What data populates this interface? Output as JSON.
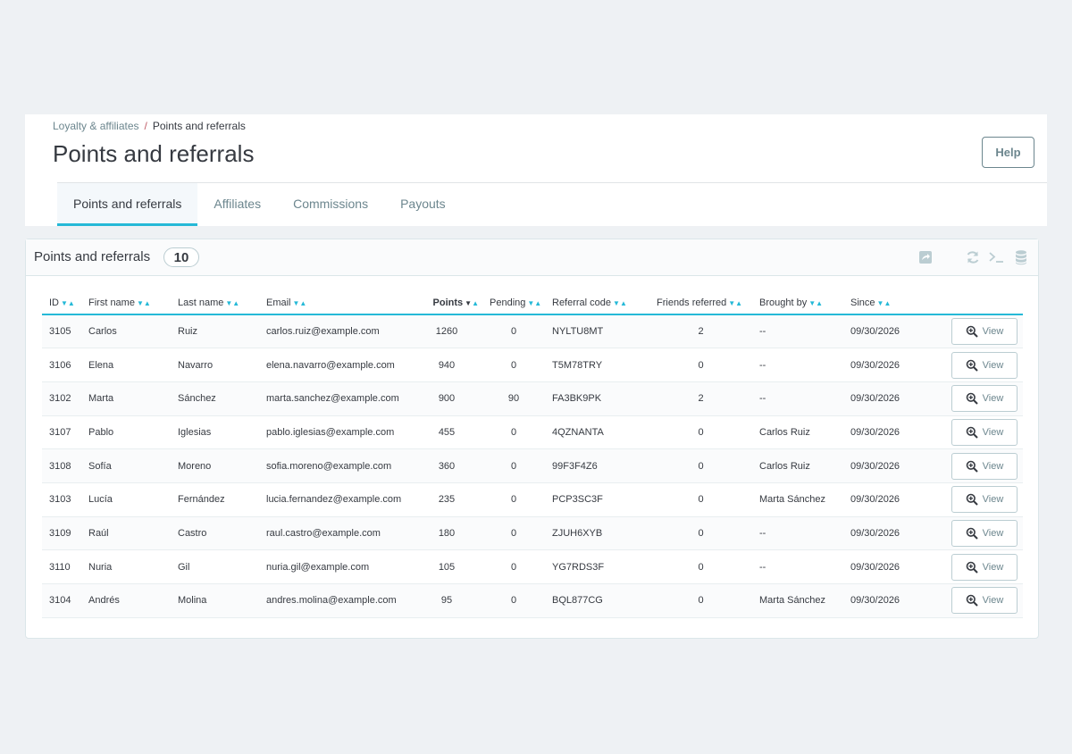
{
  "breadcrumb": {
    "parent": "Loyalty & affiliates",
    "separator": "/",
    "current": "Points and referrals"
  },
  "page_title": "Points and referrals",
  "help_label": "Help",
  "tabs": [
    {
      "label": "Points and referrals",
      "active": true
    },
    {
      "label": "Affiliates",
      "active": false
    },
    {
      "label": "Commissions",
      "active": false
    },
    {
      "label": "Payouts",
      "active": false
    }
  ],
  "panel": {
    "title": "Points and referrals",
    "count": "10",
    "tools": [
      "export-icon",
      "refresh-icon",
      "sql-query-icon",
      "database-icon"
    ]
  },
  "table": {
    "columns": [
      "ID",
      "First name",
      "Last name",
      "Email",
      "Points",
      "Pending",
      "Referral code",
      "Friends referred",
      "Brought by",
      "Since"
    ],
    "sorted_column": "Points",
    "view_label": "View",
    "rows": [
      {
        "id": "3105",
        "first": "Carlos",
        "last": "Ruiz",
        "email": "carlos.ruiz@example.com",
        "points": "1260",
        "pending": "0",
        "code": "NYLTU8MT",
        "friends": "2",
        "brought_by": "--",
        "since": "09/30/2026"
      },
      {
        "id": "3106",
        "first": "Elena",
        "last": "Navarro",
        "email": "elena.navarro@example.com",
        "points": "940",
        "pending": "0",
        "code": "T5M78TRY",
        "friends": "0",
        "brought_by": "--",
        "since": "09/30/2026"
      },
      {
        "id": "3102",
        "first": "Marta",
        "last": "Sánchez",
        "email": "marta.sanchez@example.com",
        "points": "900",
        "pending": "90",
        "code": "FA3BK9PK",
        "friends": "2",
        "brought_by": "--",
        "since": "09/30/2026"
      },
      {
        "id": "3107",
        "first": "Pablo",
        "last": "Iglesias",
        "email": "pablo.iglesias@example.com",
        "points": "455",
        "pending": "0",
        "code": "4QZNANTA",
        "friends": "0",
        "brought_by": "Carlos Ruiz",
        "since": "09/30/2026"
      },
      {
        "id": "3108",
        "first": "Sofía",
        "last": "Moreno",
        "email": "sofia.moreno@example.com",
        "points": "360",
        "pending": "0",
        "code": "99F3F4Z6",
        "friends": "0",
        "brought_by": "Carlos Ruiz",
        "since": "09/30/2026"
      },
      {
        "id": "3103",
        "first": "Lucía",
        "last": "Fernández",
        "email": "lucia.fernandez@example.com",
        "points": "235",
        "pending": "0",
        "code": "PCP3SC3F",
        "friends": "0",
        "brought_by": "Marta Sánchez",
        "since": "09/30/2026"
      },
      {
        "id": "3109",
        "first": "Raúl",
        "last": "Castro",
        "email": "raul.castro@example.com",
        "points": "180",
        "pending": "0",
        "code": "ZJUH6XYB",
        "friends": "0",
        "brought_by": "--",
        "since": "09/30/2026"
      },
      {
        "id": "3110",
        "first": "Nuria",
        "last": "Gil",
        "email": "nuria.gil@example.com",
        "points": "105",
        "pending": "0",
        "code": "YG7RDS3F",
        "friends": "0",
        "brought_by": "--",
        "since": "09/30/2026"
      },
      {
        "id": "3104",
        "first": "Andrés",
        "last": "Molina",
        "email": "andres.molina@example.com",
        "points": "95",
        "pending": "0",
        "code": "BQL877CG",
        "friends": "0",
        "brought_by": "Marta Sánchez",
        "since": "09/30/2026"
      }
    ]
  },
  "colors": {
    "accent": "#25b9d7",
    "text": "#363a41",
    "muted": "#6c868e",
    "background": "#eef1f4"
  }
}
